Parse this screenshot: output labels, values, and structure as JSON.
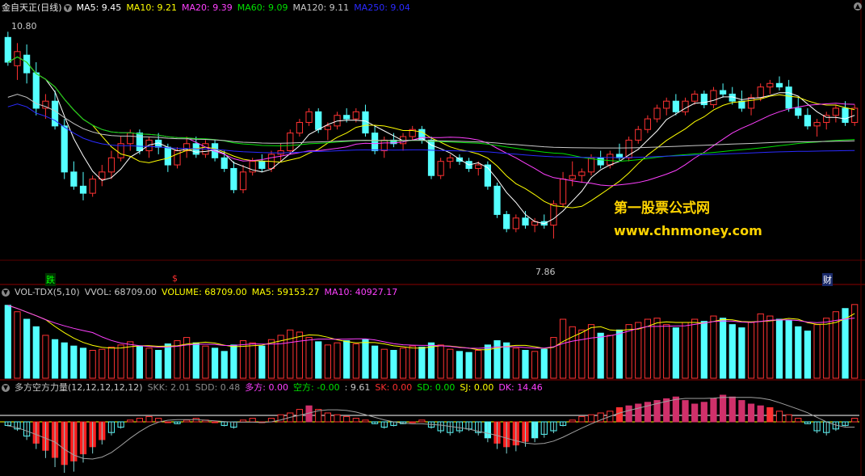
{
  "main": {
    "name": "金自天正(日线)",
    "ma": [
      {
        "label": "MA5: 9.45",
        "color": "#ffffff"
      },
      {
        "label": "MA10: 9.21",
        "color": "#ffff00"
      },
      {
        "label": "MA20: 9.39",
        "color": "#ff40ff"
      },
      {
        "label": "MA60: 9.09",
        "color": "#00e000"
      },
      {
        "label": "MA120: 9.11",
        "color": "#c8c8c8"
      },
      {
        "label": "MA250: 9.04",
        "color": "#2a2aff"
      }
    ],
    "high_label": "10.80",
    "low_label": "7.86",
    "markers": {
      "die": "跌",
      "s": "$",
      "cai": "财"
    },
    "watermark_cn": "第一股票公式网",
    "watermark_url": "www.chnmoney.com"
  },
  "vol": {
    "name": "VOL-TDX(5,10)",
    "items": [
      {
        "label": "VVOL: 68709.00",
        "color": "#c8c8c8"
      },
      {
        "label": "VOLUME: 68709.00",
        "color": "#ffff00"
      },
      {
        "label": "MA5: 59153.27",
        "color": "#ffff00"
      },
      {
        "label": "MA10: 40927.17",
        "color": "#ff40ff"
      }
    ]
  },
  "ind": {
    "name": "多方空方力量(12,12,12,12,12)",
    "items": [
      {
        "label": "SKK: 2.01",
        "color": "#8a8a8a"
      },
      {
        "label": "SDD: 0.48",
        "color": "#8a8a8a"
      },
      {
        "label": "多方: 0.00",
        "color": "#ff40ff"
      },
      {
        "label": "空方: -0.00",
        "color": "#00e000"
      },
      {
        "label": ": 9.61",
        "color": "#c8c8c8"
      },
      {
        "label": "SK: 0.00",
        "color": "#ff3030"
      },
      {
        "label": "SD: 0.00",
        "color": "#00e000"
      },
      {
        "label": "SJ: 0.00",
        "color": "#ffff00"
      },
      {
        "label": "DK: 14.46",
        "color": "#ff40ff"
      }
    ]
  },
  "chart_data": [
    {
      "type": "candlestick",
      "title": "金自天正(日线)",
      "ylim": [
        7.6,
        11.0
      ],
      "high": 10.8,
      "low": 7.86,
      "ohlc": [
        [
          10.7,
          10.78,
          10.3,
          10.35
        ],
        [
          10.3,
          10.62,
          10.1,
          10.5
        ],
        [
          10.45,
          10.6,
          10.05,
          10.2
        ],
        [
          10.2,
          10.35,
          9.6,
          9.7
        ],
        [
          9.7,
          9.9,
          9.55,
          9.8
        ],
        [
          9.8,
          9.95,
          9.4,
          9.45
        ],
        [
          9.45,
          9.55,
          8.7,
          8.8
        ],
        [
          8.8,
          8.95,
          8.55,
          8.6
        ],
        [
          8.6,
          8.8,
          8.4,
          8.5
        ],
        [
          8.5,
          8.75,
          8.45,
          8.7
        ],
        [
          8.7,
          8.9,
          8.6,
          8.8
        ],
        [
          8.8,
          9.1,
          8.7,
          9.0
        ],
        [
          9.0,
          9.3,
          8.95,
          9.2
        ],
        [
          9.2,
          9.4,
          9.1,
          9.35
        ],
        [
          9.35,
          9.4,
          9.05,
          9.1
        ],
        [
          9.1,
          9.3,
          9.0,
          9.25
        ],
        [
          9.25,
          9.35,
          9.05,
          9.15
        ],
        [
          9.15,
          9.2,
          8.8,
          8.9
        ],
        [
          8.9,
          9.15,
          8.85,
          9.1
        ],
        [
          9.1,
          9.3,
          9.0,
          9.2
        ],
        [
          9.2,
          9.3,
          9.0,
          9.05
        ],
        [
          9.05,
          9.25,
          9.0,
          9.2
        ],
        [
          9.2,
          9.25,
          8.95,
          9.0
        ],
        [
          9.0,
          9.1,
          8.8,
          8.85
        ],
        [
          8.85,
          8.95,
          8.5,
          8.55
        ],
        [
          8.55,
          8.9,
          8.5,
          8.8
        ],
        [
          8.8,
          9.0,
          8.75,
          8.95
        ],
        [
          8.95,
          9.05,
          8.8,
          8.85
        ],
        [
          8.85,
          9.1,
          8.8,
          9.05
        ],
        [
          9.05,
          9.2,
          8.95,
          9.1
        ],
        [
          9.1,
          9.4,
          9.05,
          9.35
        ],
        [
          9.35,
          9.55,
          9.3,
          9.5
        ],
        [
          9.5,
          9.7,
          9.45,
          9.65
        ],
        [
          9.65,
          9.7,
          9.35,
          9.4
        ],
        [
          9.4,
          9.5,
          9.25,
          9.45
        ],
        [
          9.45,
          9.65,
          9.4,
          9.6
        ],
        [
          9.6,
          9.7,
          9.5,
          9.55
        ],
        [
          9.55,
          9.7,
          9.5,
          9.65
        ],
        [
          9.65,
          9.75,
          9.3,
          9.35
        ],
        [
          9.35,
          9.45,
          9.05,
          9.1
        ],
        [
          9.1,
          9.3,
          9.0,
          9.25
        ],
        [
          9.25,
          9.35,
          9.15,
          9.2
        ],
        [
          9.2,
          9.35,
          9.1,
          9.3
        ],
        [
          9.3,
          9.45,
          9.25,
          9.4
        ],
        [
          9.4,
          9.45,
          9.2,
          9.25
        ],
        [
          9.25,
          9.3,
          8.7,
          8.75
        ],
        [
          8.75,
          9.0,
          8.7,
          8.95
        ],
        [
          8.95,
          9.05,
          8.85,
          9.0
        ],
        [
          9.0,
          9.05,
          8.9,
          8.95
        ],
        [
          8.95,
          9.0,
          8.8,
          8.85
        ],
        [
          8.85,
          8.95,
          8.75,
          8.9
        ],
        [
          8.9,
          8.95,
          8.55,
          8.6
        ],
        [
          8.6,
          8.65,
          8.15,
          8.2
        ],
        [
          8.2,
          8.25,
          7.95,
          8.0
        ],
        [
          8.0,
          8.2,
          7.95,
          8.15
        ],
        [
          8.15,
          8.25,
          8.0,
          8.05
        ],
        [
          8.05,
          8.15,
          7.95,
          8.1
        ],
        [
          8.1,
          8.2,
          8.0,
          8.05
        ],
        [
          8.05,
          8.4,
          7.86,
          8.35
        ],
        [
          8.35,
          8.8,
          8.3,
          8.7
        ],
        [
          8.7,
          8.95,
          8.6,
          8.75
        ],
        [
          8.75,
          8.85,
          8.65,
          8.8
        ],
        [
          8.8,
          9.05,
          8.75,
          9.0
        ],
        [
          9.0,
          9.1,
          8.85,
          8.9
        ],
        [
          8.9,
          9.1,
          8.85,
          9.05
        ],
        [
          9.05,
          9.2,
          8.95,
          9.0
        ],
        [
          9.0,
          9.3,
          8.95,
          9.25
        ],
        [
          9.25,
          9.45,
          9.2,
          9.4
        ],
        [
          9.4,
          9.6,
          9.35,
          9.55
        ],
        [
          9.55,
          9.75,
          9.5,
          9.7
        ],
        [
          9.7,
          9.85,
          9.6,
          9.8
        ],
        [
          9.8,
          9.9,
          9.6,
          9.65
        ],
        [
          9.65,
          9.85,
          9.6,
          9.8
        ],
        [
          9.8,
          9.95,
          9.75,
          9.9
        ],
        [
          9.9,
          9.95,
          9.7,
          9.75
        ],
        [
          9.75,
          10.0,
          9.7,
          9.95
        ],
        [
          9.95,
          10.05,
          9.85,
          9.9
        ],
        [
          9.9,
          10.0,
          9.75,
          9.8
        ],
        [
          9.8,
          9.95,
          9.65,
          9.7
        ],
        [
          9.7,
          9.9,
          9.6,
          9.85
        ],
        [
          9.85,
          10.05,
          9.8,
          10.0
        ],
        [
          10.0,
          10.1,
          9.9,
          10.05
        ],
        [
          10.05,
          10.15,
          9.95,
          10.0
        ],
        [
          10.0,
          10.1,
          9.65,
          9.7
        ],
        [
          9.7,
          9.85,
          9.55,
          9.6
        ],
        [
          9.6,
          9.7,
          9.4,
          9.45
        ],
        [
          9.45,
          9.55,
          9.3,
          9.5
        ],
        [
          9.5,
          9.65,
          9.4,
          9.6
        ],
        [
          9.6,
          9.75,
          9.5,
          9.7
        ],
        [
          9.7,
          9.8,
          9.45,
          9.5
        ],
        [
          9.5,
          9.75,
          9.45,
          9.7
        ]
      ]
    },
    {
      "type": "bar",
      "title": "VOL-TDX(5,10)",
      "values": [
        68000,
        62000,
        55000,
        48000,
        40000,
        36000,
        33000,
        30000,
        28000,
        26000,
        27000,
        29000,
        31000,
        34000,
        30000,
        28000,
        26000,
        32000,
        35000,
        38000,
        33000,
        30000,
        28000,
        25000,
        31000,
        35000,
        33000,
        30000,
        36000,
        40000,
        45000,
        43000,
        38000,
        34000,
        31000,
        33000,
        35000,
        32000,
        36000,
        30000,
        27000,
        26000,
        28000,
        30000,
        29000,
        33000,
        31000,
        27000,
        25000,
        24000,
        26000,
        31000,
        35000,
        33000,
        28000,
        26000,
        25000,
        27000,
        38000,
        55000,
        48000,
        45000,
        50000,
        42000,
        40000,
        45000,
        50000,
        52000,
        55000,
        56000,
        50000,
        47000,
        52000,
        55000,
        53000,
        58000,
        56000,
        50000,
        47000,
        52000,
        60000,
        58000,
        55000,
        54000,
        48000,
        44000,
        50000,
        56000,
        62000,
        65000,
        68709
      ],
      "ma5": 59153.27,
      "ma10": 40927.17
    },
    {
      "type": "bar",
      "title": "多方空方力量(12,12,12,12,12)",
      "values": [
        -0.2,
        -0.4,
        -0.8,
        -1.2,
        -1.6,
        -2.0,
        -2.4,
        -2.2,
        -1.8,
        -1.4,
        -1.0,
        -0.6,
        -0.3,
        0.1,
        0.2,
        0.3,
        0.2,
        0.0,
        -0.1,
        0.1,
        0.2,
        0.1,
        0.0,
        -0.2,
        -0.3,
        0.1,
        0.2,
        0.0,
        0.2,
        0.4,
        0.5,
        0.7,
        0.9,
        0.7,
        0.5,
        0.4,
        0.3,
        0.2,
        0.1,
        -0.1,
        -0.3,
        -0.2,
        -0.1,
        0.0,
        0.1,
        -0.3,
        -0.5,
        -0.6,
        -0.5,
        -0.4,
        -0.6,
        -0.9,
        -1.2,
        -1.4,
        -1.3,
        -1.1,
        -0.9,
        -0.7,
        -0.5,
        -0.2,
        0.1,
        0.3,
        0.4,
        0.5,
        0.6,
        0.8,
        0.9,
        1.0,
        1.1,
        1.2,
        1.3,
        1.4,
        1.2,
        1.0,
        1.1,
        1.3,
        1.5,
        1.4,
        1.2,
        1.0,
        0.9,
        0.8,
        0.6,
        0.4,
        0.2,
        -0.1,
        -0.5,
        -0.6,
        -0.4,
        -0.2,
        0.2
      ],
      "SKK": 2.01,
      "SDD": 0.48,
      "DK": 14.46
    }
  ]
}
